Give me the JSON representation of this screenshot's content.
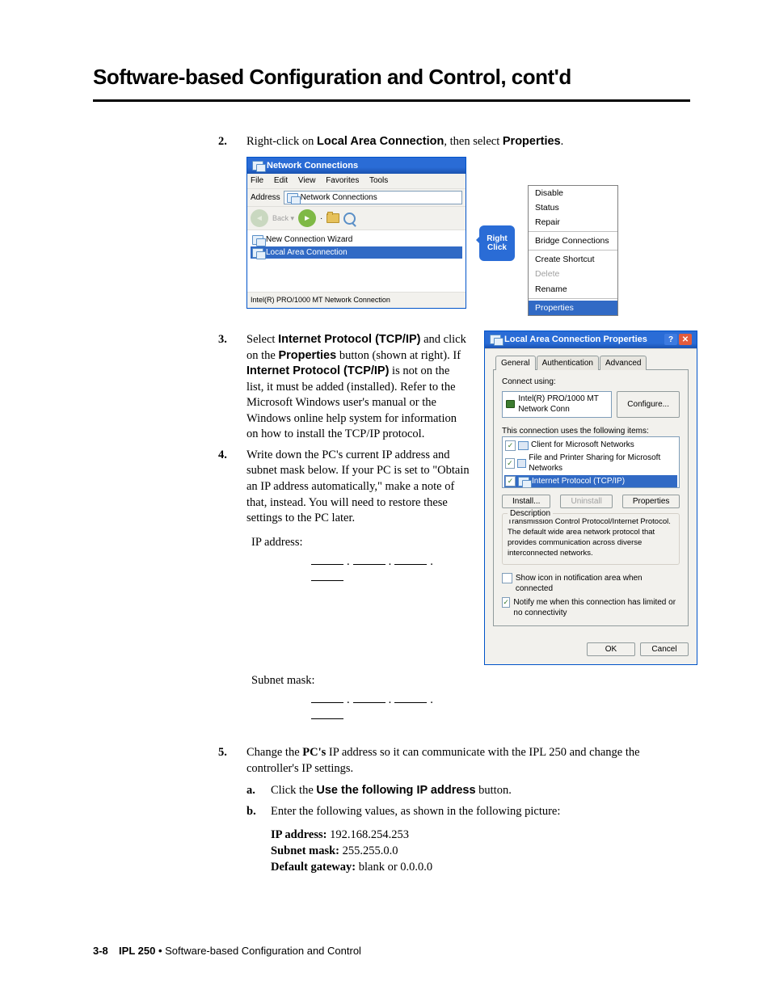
{
  "page_title": "Software-based Configuration and Control, cont'd",
  "steps": {
    "s2": {
      "num": "2.",
      "pre": "Right-click on ",
      "bold1": "Local Area Connection",
      "mid": ", then select ",
      "bold2": "Properties",
      "post": "."
    },
    "s3": {
      "num": "3.",
      "p_a": "Select ",
      "p_b": "Internet Protocol (TCP/IP)",
      "p_c": " and click on the ",
      "p_d": "Properties",
      "p_e": " button (shown at right).  If ",
      "p_f": "Internet Protocol (TCP/IP)",
      "p_g": " is not on the list, it must be added (installed).  Refer to the Microsoft Windows user's manual or the Windows online help system for information on how to install the TCP/IP protocol."
    },
    "s4": {
      "num": "4.",
      "text": "Write down the PC's current IP address and subnet mask below.  If your PC is set to \"Obtain an IP address automatically,\" make a note of that, instead.  You will need to restore these settings to the PC later.",
      "ip_label": "IP address:",
      "sm_label": "Subnet mask:"
    },
    "s5": {
      "num": "5.",
      "pre": "Change the ",
      "bold": "PC's",
      "post": " IP address so it can communicate with the IPL 250 and change the controller's IP settings.",
      "a_num": "a.",
      "a_pre": "Click the ",
      "a_bold": "Use the following IP address",
      "a_post": " button.",
      "b_num": "b.",
      "b_text": "Enter the following values, as shown in the following picture:",
      "ip_lbl": "IP address:",
      "ip_val": " 192.168.254.253",
      "sm_lbl": "Subnet mask:",
      "sm_val": " 255.255.0.0",
      "gw_lbl": "Default gateway:",
      "gw_val": " blank or 0.0.0.0"
    }
  },
  "netwin": {
    "title": "Network Connections",
    "menu_file": "File",
    "menu_edit": "Edit",
    "menu_view": "View",
    "menu_fav": "Favorites",
    "menu_tools": "Tools",
    "addr_lbl": "Address",
    "addr_val": "Network Connections",
    "item_wiz": "New Connection Wizard",
    "item_lan": "Local Area Connection",
    "status": "Intel(R) PRO/1000 MT Network Connection"
  },
  "bubble": {
    "l1": "Right",
    "l2": "Click"
  },
  "ctx": {
    "disable": "Disable",
    "status": "Status",
    "repair": "Repair",
    "bridge": "Bridge Connections",
    "shortcut": "Create Shortcut",
    "delete": "Delete",
    "rename": "Rename",
    "props": "Properties"
  },
  "dlg": {
    "title": "Local Area Connection Properties",
    "tab_gen": "General",
    "tab_auth": "Authentication",
    "tab_adv": "Advanced",
    "connect_using": "Connect using:",
    "adapter": "Intel(R) PRO/1000 MT Network Conn",
    "configure": "Configure...",
    "uses_items": "This connection uses the following items:",
    "item1": "Client for Microsoft Networks",
    "item2": "File and Printer Sharing for Microsoft Networks",
    "item3": "Internet Protocol (TCP/IP)",
    "install": "Install...",
    "uninstall": "Uninstall",
    "properties": "Properties",
    "desc_title": "Description",
    "desc_text": "Transmission Control Protocol/Internet Protocol. The default wide area network protocol that provides communication across diverse interconnected networks.",
    "show_icon": "Show icon in notification area when connected",
    "notify": "Notify me when this connection has limited or no connectivity",
    "ok": "OK",
    "cancel": "Cancel"
  },
  "footer": {
    "pg": "3-8",
    "sect": "IPL 250 • ",
    "sub": "Software-based Configuration and Control"
  }
}
